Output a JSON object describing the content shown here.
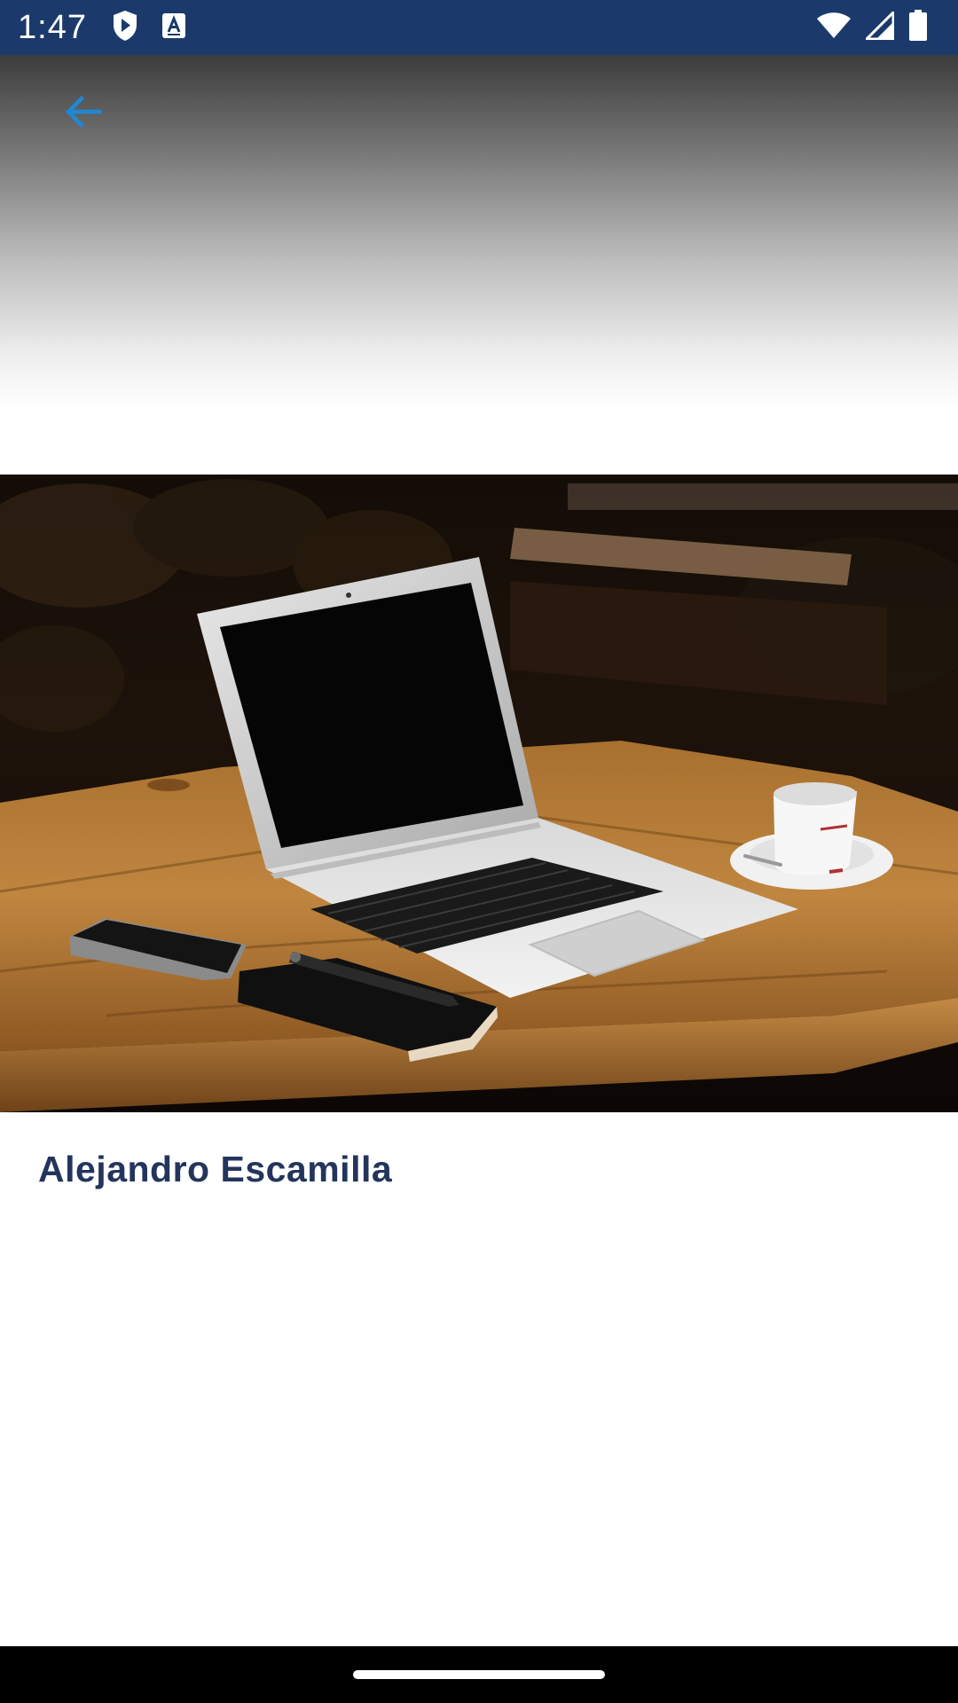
{
  "status_bar": {
    "time": "1:47",
    "left_icons": [
      "shield-play-icon",
      "font-a-icon"
    ],
    "right_icons": [
      "wifi-icon",
      "cell-signal-icon",
      "battery-icon"
    ],
    "background_color": "#1b3a6b"
  },
  "toolbar": {
    "back_icon": "arrow-back-icon",
    "accent_color": "#1e88d6"
  },
  "photo": {
    "subject": "laptop-on-wooden-table"
  },
  "author": {
    "name": "Alejandro Escamilla",
    "text_color": "#23355c"
  }
}
